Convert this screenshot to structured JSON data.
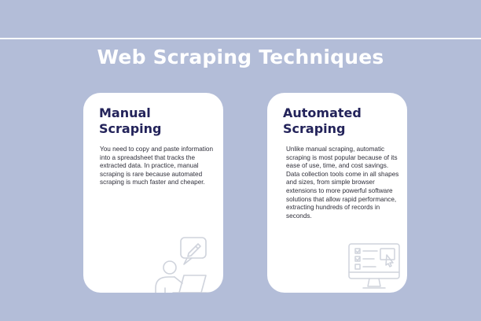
{
  "page": {
    "title": "Web Scraping Techniques"
  },
  "cards": [
    {
      "title_line1": "Manual",
      "title_line2": "Scraping",
      "body": "You need to copy and paste information into a spreadsheet that tracks the extracted data. In practice, manual scraping is rare because automated scraping is much faster and cheaper.",
      "icon": "person-laptop-speech-bubble-icon"
    },
    {
      "title_line1": "Automated",
      "title_line2": "Scraping",
      "body": "Unlike manual scraping, automatic scraping is most popular because of its ease of use, time, and cost savings. Data collection tools come in all shapes and sizes, from simple browser extensions to more powerful software solutions that allow rapid performance, extracting hundreds of records in seconds.",
      "icon": "monitor-checklist-cursor-icon"
    }
  ],
  "colors": {
    "background": "#b3bdd8",
    "title_text": "#ffffff",
    "card_background": "#ffffff",
    "card_heading": "#23235a",
    "illustration_stroke": "#cfd3dc"
  }
}
